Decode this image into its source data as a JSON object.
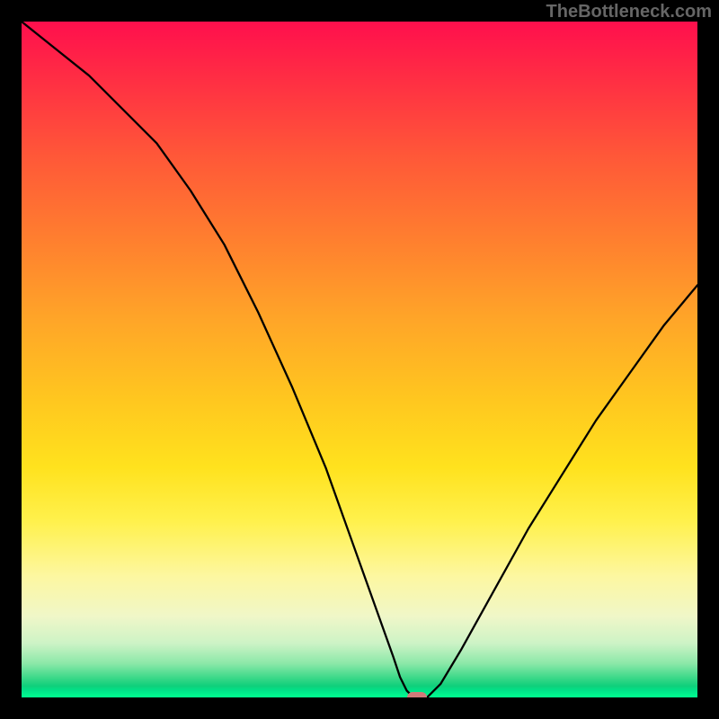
{
  "attribution": "TheBottleneck.com",
  "colors": {
    "page_bg": "#000000",
    "curve": "#000000",
    "marker": "#d07a7a",
    "gradient_top": "#ff0f4d",
    "gradient_bottom": "#00ff90"
  },
  "chart_data": {
    "type": "line",
    "title": "",
    "xlabel": "",
    "ylabel": "",
    "xlim": [
      0,
      100
    ],
    "ylim": [
      0,
      100
    ],
    "series": [
      {
        "name": "bottleneck-curve",
        "x": [
          0,
          5,
          10,
          15,
          20,
          25,
          30,
          35,
          40,
          45,
          50,
          55,
          56,
          57,
          58,
          60,
          62,
          65,
          70,
          75,
          80,
          85,
          90,
          95,
          100
        ],
        "y": [
          100,
          96,
          92,
          87,
          82,
          75,
          67,
          57,
          46,
          34,
          20,
          6,
          3,
          1,
          0,
          0,
          2,
          7,
          16,
          25,
          33,
          41,
          48,
          55,
          61
        ]
      }
    ],
    "marker": {
      "x": 58.5,
      "y": 0,
      "shape": "rounded-rect",
      "color": "#d07a7a"
    }
  }
}
